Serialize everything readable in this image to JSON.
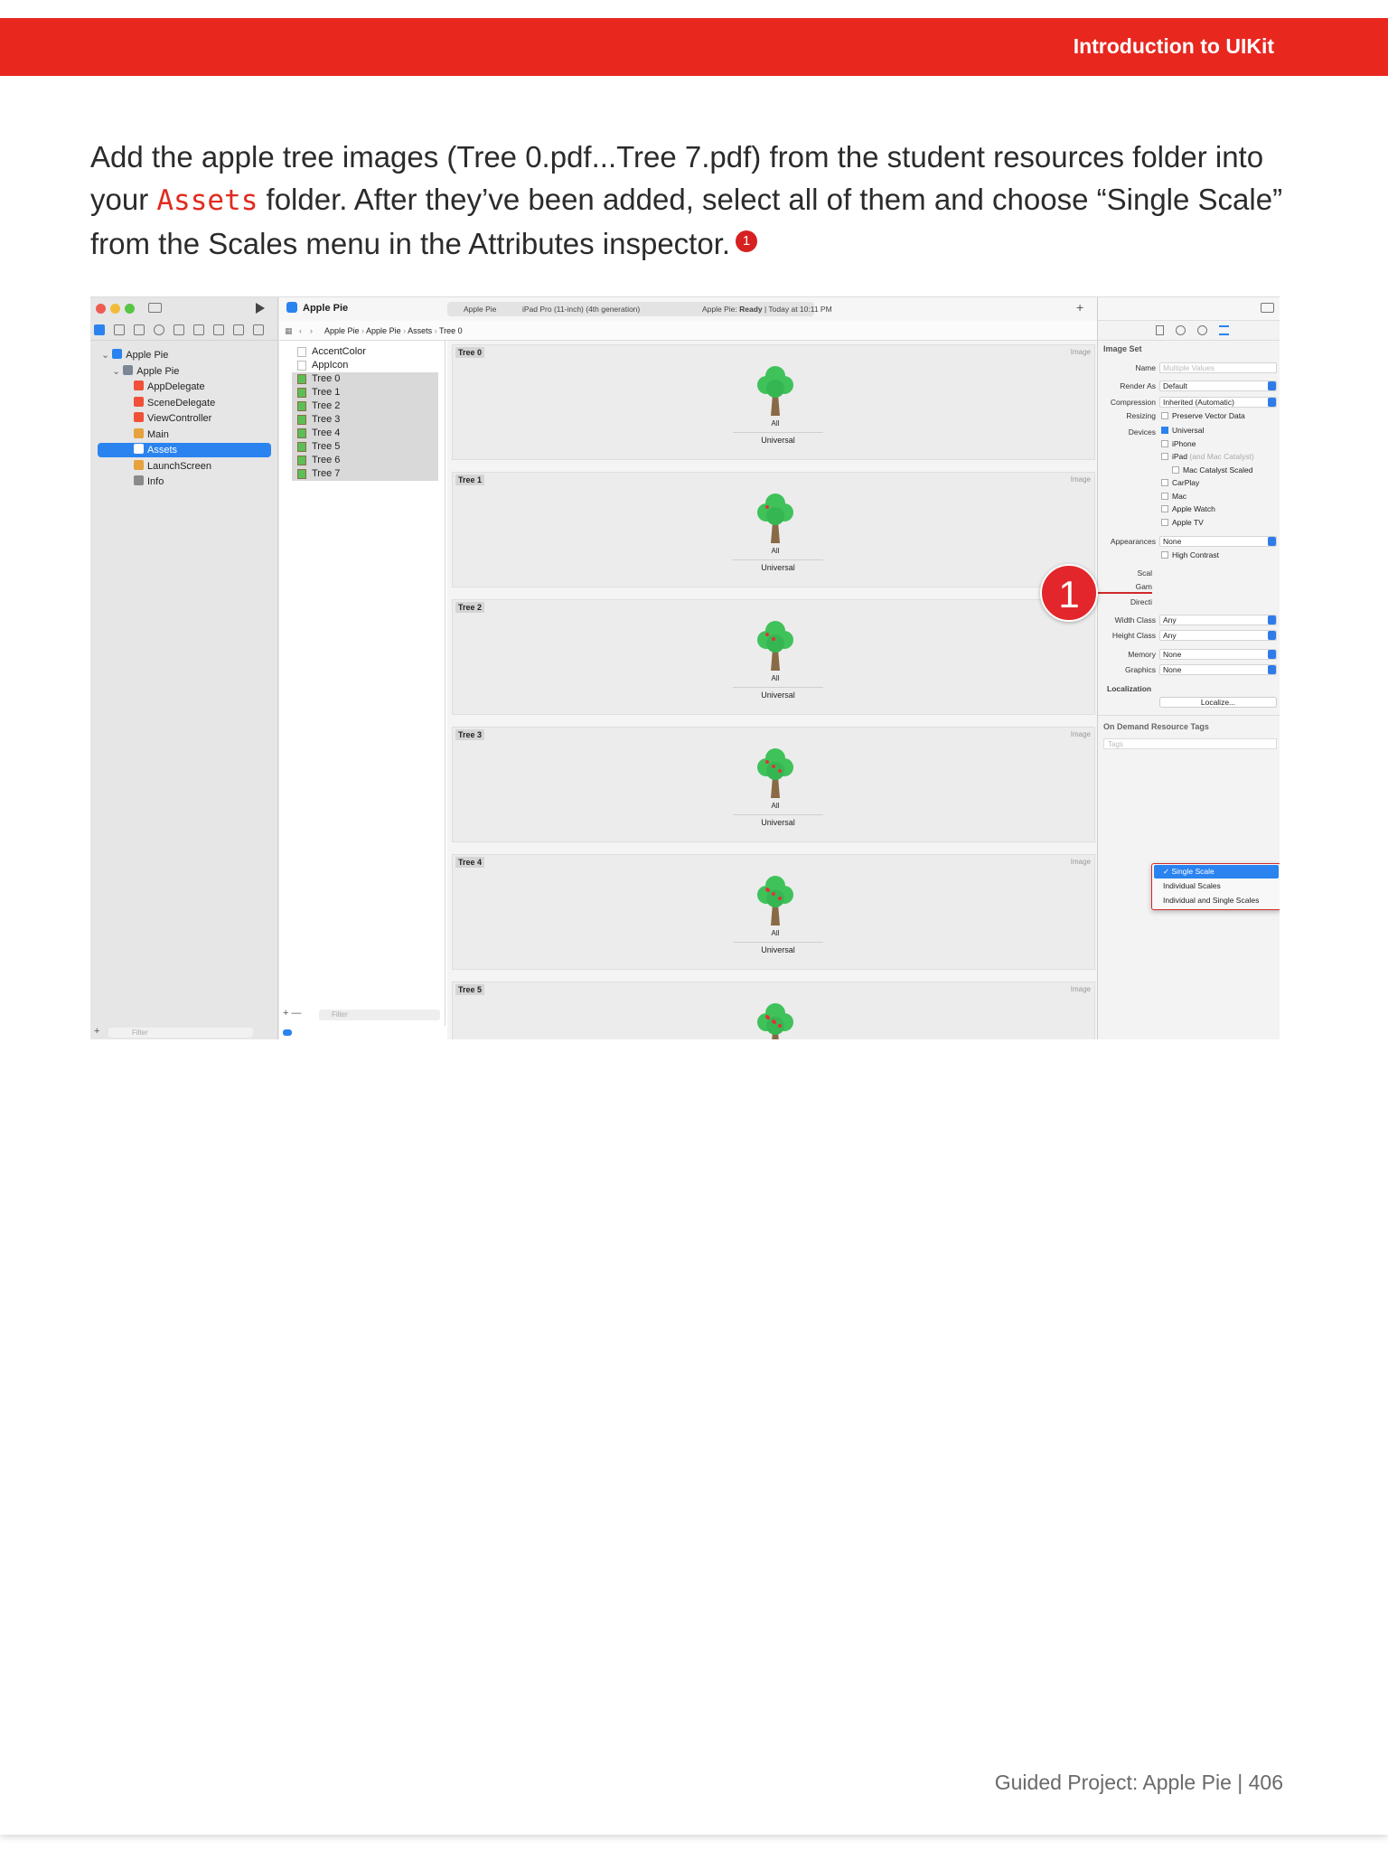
{
  "header": {
    "section_title": "Introduction to UIKit"
  },
  "body": {
    "text_part1": "Add the apple tree images (Tree 0.pdf...Tree 7.pdf) from the student resources folder into your ",
    "code_word": "Assets",
    "text_part2": " folder. After they’ve been added, select all of them and choose “Single Scale” from the Scales menu in the Attributes inspector.",
    "callout_number": "1"
  },
  "screenshot": {
    "scheme": "Apple Pie",
    "device_tab_app": "Apple Pie",
    "device_tab_device": "iPad Pro (11-inch) (4th generation)",
    "status_prefix": "Apple Pie: ",
    "status_state": "Ready",
    "status_time": " | Today at 10:11 PM",
    "breadcrumb": [
      "Apple Pie",
      "Apple Pie",
      "Assets",
      "Tree 0"
    ],
    "navigator": [
      {
        "label": "Apple Pie",
        "indent": 0,
        "icon": "app-icon"
      },
      {
        "label": "Apple Pie",
        "indent": 1,
        "icon": "folder-icon"
      },
      {
        "label": "AppDelegate",
        "indent": 2,
        "icon": "swift-icon"
      },
      {
        "label": "SceneDelegate",
        "indent": 2,
        "icon": "swift-icon"
      },
      {
        "label": "ViewController",
        "indent": 2,
        "icon": "swift-icon"
      },
      {
        "label": "Main",
        "indent": 2,
        "icon": "storyboard-icon"
      },
      {
        "label": "Assets",
        "indent": 2,
        "icon": "assets-icon",
        "selected": true
      },
      {
        "label": "LaunchScreen",
        "indent": 2,
        "icon": "storyboard-icon"
      },
      {
        "label": "Info",
        "indent": 2,
        "icon": "plist-icon"
      }
    ],
    "nav_filter_placeholder": "Filter",
    "asset_list": [
      "AccentColor",
      "AppIcon",
      "Tree 0",
      "Tree 1",
      "Tree 2",
      "Tree 3",
      "Tree 4",
      "Tree 5",
      "Tree 6",
      "Tree 7"
    ],
    "asset_filter_placeholder": "Filter",
    "image_sets": [
      {
        "name": "Tree 0",
        "type": "Image",
        "scale_label": "All",
        "device_label": "Universal"
      },
      {
        "name": "Tree 1",
        "type": "Image",
        "scale_label": "All",
        "device_label": "Universal"
      },
      {
        "name": "Tree 2",
        "type": "Image",
        "scale_label": "All",
        "device_label": "Universal"
      },
      {
        "name": "Tree 3",
        "type": "Image",
        "scale_label": "All",
        "device_label": "Universal"
      },
      {
        "name": "Tree 4",
        "type": "Image",
        "scale_label": "All",
        "device_label": "Universal"
      },
      {
        "name": "Tree 5",
        "type": "Image",
        "scale_label": "",
        "device_label": ""
      }
    ],
    "inspector": {
      "section": "Image Set",
      "name_label": "Name",
      "name_placeholder": "Multiple Values",
      "render_as_label": "Render As",
      "render_as_value": "Default",
      "compression_label": "Compression",
      "compression_value": "Inherited (Automatic)",
      "resizing_label": "Resizing",
      "resizing_value": "Preserve Vector Data",
      "devices_label": "Devices",
      "devices": [
        "Universal",
        "iPhone",
        "iPad",
        "Mac Catalyst Scaled",
        "CarPlay",
        "Mac",
        "Apple Watch",
        "Apple TV"
      ],
      "ipad_note": "(and Mac Catalyst)",
      "appearances_label": "Appearances",
      "appearances_value": "None",
      "high_contrast": "High Contrast",
      "scales_label": "Scal",
      "gamut_label": "Gam",
      "direction_label": "Directi",
      "width_class_label": "Width Class",
      "width_class_value": "Any",
      "height_class_label": "Height Class",
      "height_class_value": "Any",
      "memory_label": "Memory",
      "memory_value": "None",
      "graphics_label": "Graphics",
      "graphics_value": "None",
      "localization_label": "Localization",
      "localize_button": "Localize...",
      "odr_label": "On Demand Resource Tags",
      "tags_placeholder": "Tags"
    },
    "scales_menu": {
      "options": [
        "Single Scale",
        "Individual Scales",
        "Individual and Single Scales"
      ],
      "selected": "Single Scale"
    },
    "callout_number": "1"
  },
  "footer": {
    "text": "Guided Project: Apple Pie  |  406"
  },
  "colors": {
    "accent_red": "#e8271f",
    "selection_blue": "#2a83ef"
  }
}
